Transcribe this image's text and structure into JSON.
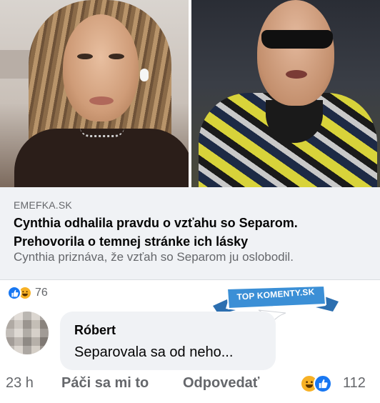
{
  "link_preview": {
    "domain": "EMEFKA.SK",
    "headline": "Cynthia odhalila pravdu o vzťahu so Separom. Prehovorila o temnej stránke ich lásky",
    "description": "Cynthia priznáva, že vzťah so Separom ju oslobodil."
  },
  "post_reactions": {
    "count": "76",
    "icons": [
      "like-icon",
      "haha-icon"
    ]
  },
  "badge": {
    "text": "TOP KOMENTY.SK",
    "color": "#3b8fd6"
  },
  "comment": {
    "author": "Róbert",
    "text": "Separovala sa od neho...",
    "time": "23 h",
    "like_label": "Páči sa mi to",
    "reply_label": "Odpovedať",
    "reaction_count": "112",
    "reaction_icons": [
      "haha-icon",
      "like-icon"
    ]
  },
  "colors": {
    "secondary_text": "#65676b",
    "card_background": "#f0f2f5",
    "like_blue": "#1877f2",
    "haha_yellow": "#f7b125"
  }
}
